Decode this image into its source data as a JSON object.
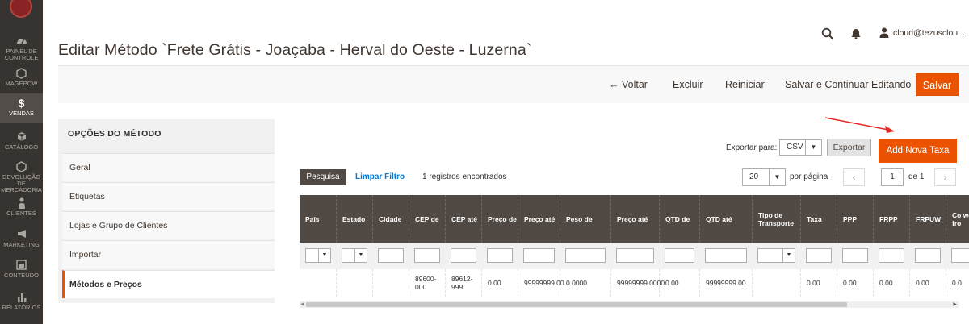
{
  "colors": {
    "accent": "#eb5202",
    "sidebar_bg": "#373330",
    "header_bg": "#514943",
    "link": "#007bdb",
    "arrow": "#e02b27"
  },
  "sidebar": {
    "items": [
      {
        "label": "PAINEL DE CONTROLE",
        "icon": "dashboard-icon"
      },
      {
        "label": "MAGEPOW",
        "icon": "hexagon-icon"
      },
      {
        "label": "VENDAS",
        "icon": "dollar-icon"
      },
      {
        "label": "CATÁLOGO",
        "icon": "cube-icon"
      },
      {
        "label": "DEVOLUÇÃO DE MERCADORIA",
        "icon": "hexagon-icon"
      },
      {
        "label": "CLIENTES",
        "icon": "person-icon"
      },
      {
        "label": "MARKETING",
        "icon": "megaphone-icon"
      },
      {
        "label": "CONTEÚDO",
        "icon": "layout-icon"
      },
      {
        "label": "RELATÓRIOS",
        "icon": "bar-chart-icon"
      }
    ]
  },
  "header": {
    "title": "Editar Método `Frete Grátis - Joaçaba - Herval do Oeste - Luzerna`",
    "user": "cloud@tezusclou..."
  },
  "actions": {
    "back": "← Voltar",
    "delete": "Excluir",
    "reset": "Reiniciar",
    "save_continue": "Salvar e Continuar Editando",
    "save": "Salvar"
  },
  "panel": {
    "title": "OPÇÕES DO MÉTODO",
    "items": [
      "Geral",
      "Etiquetas",
      "Lojas e Grupo de Clientes",
      "Importar",
      "Métodos e Preços"
    ]
  },
  "grid": {
    "export_label": "Exportar para:",
    "export_format": "CSV",
    "export_button": "Exportar",
    "add_button": "Add Nova Taxa",
    "search_button": "Pesquisa",
    "reset_filter": "Limpar Filtro",
    "records": "1 registros encontrados",
    "per_page": "20",
    "per_page_label": "por página",
    "page": "1",
    "of_pages": "de 1",
    "columns": [
      "País",
      "Estado",
      "Cidade",
      "CEP de",
      "CEP até",
      "Preço de",
      "Preço até",
      "Peso de",
      "Preço até",
      "QTD de",
      "QTD até",
      "Tipo de Transporte",
      "Taxa",
      "PPP",
      "FRPP",
      "FRPUW",
      "Co we fro"
    ],
    "rows": [
      [
        "",
        "",
        "",
        "89600-000",
        "89612-999",
        "0.00",
        "99999999.00",
        "0.0000",
        "99999999.0000",
        "0.00",
        "99999999.00",
        "",
        "0.00",
        "0.00",
        "0.00",
        "0.00",
        "0.0"
      ]
    ]
  }
}
